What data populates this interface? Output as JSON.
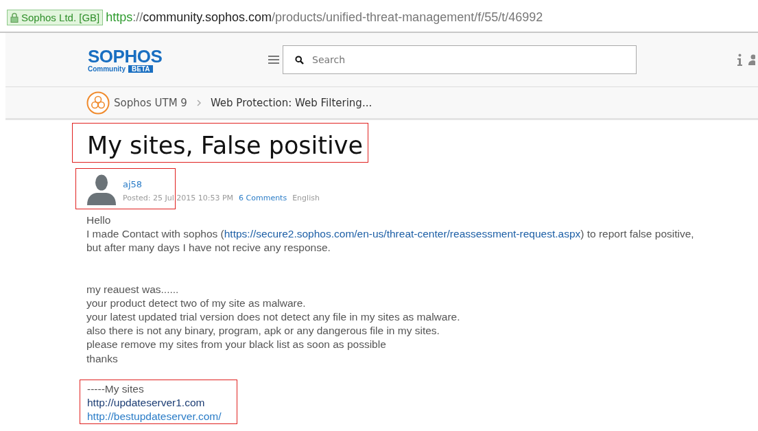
{
  "address_bar": {
    "identity": "Sophos Ltd. [GB]",
    "scheme": "https",
    "separator": "://",
    "host": "community.sophos.com",
    "path": "/products/unified-threat-management/f/55/t/46992"
  },
  "header": {
    "logo": "SOPHOS",
    "logo_sub": "Community",
    "logo_badge": "BETA",
    "search": {
      "placeholder": "Search"
    }
  },
  "breadcrumb": [
    {
      "label": "Sophos UTM 9"
    },
    {
      "label": "Web Protection: Web Filtering..."
    }
  ],
  "post": {
    "title": "My sites, False positive",
    "title_highlighted": true,
    "author": {
      "name": "aj58",
      "highlighted": true
    },
    "meta": {
      "posted": "Posted: 25 Jul 2015 10:53 PM",
      "comments": "6 Comments",
      "language": "English"
    },
    "paragraphs": [
      {
        "highlighted": false,
        "lines": [
          {
            "kind": "text",
            "text": "Hello"
          },
          {
            "kind": "link_inline",
            "before": "I made Contact with sophos (",
            "link": "https://secure2.sophos.com/en-us/threat-center/reassessment-request.aspx",
            "after": ") to report false positive,"
          },
          {
            "kind": "text",
            "text": "but after many days I have not recive any response."
          }
        ]
      },
      {
        "highlighted": false,
        "lines": [
          {
            "kind": "text",
            "text": "my reauest was......"
          },
          {
            "kind": "text",
            "text": "your product detect two of my site as malware."
          },
          {
            "kind": "text",
            "text": "your latest updated trial version does not detect any file in my sites as malware."
          },
          {
            "kind": "text",
            "text": "also there is not any binary, program, apk or any dangerous file in my sites."
          },
          {
            "kind": "text",
            "text": "please remove my sites from your black list as soon as possible"
          },
          {
            "kind": "text",
            "text": "thanks"
          }
        ]
      },
      {
        "highlighted": true,
        "lines": [
          {
            "kind": "text",
            "text": "-----My sites"
          },
          {
            "kind": "link",
            "text": "http://updateserver1.com",
            "visited": true
          },
          {
            "kind": "link",
            "text": "http://bestupdateserver.com/",
            "visited": false
          }
        ]
      }
    ]
  }
}
